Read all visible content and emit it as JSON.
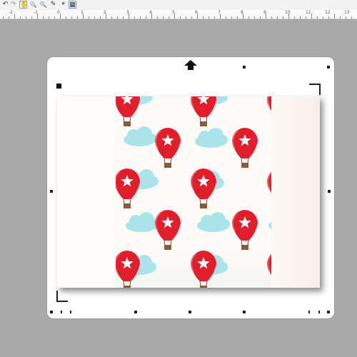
{
  "toolbar": {
    "tools": [
      {
        "name": "undo-icon",
        "glyph": "↶"
      },
      {
        "name": "redo-icon",
        "glyph": "↷"
      },
      {
        "name": "pan-hand-icon",
        "glyph": "✋"
      },
      {
        "name": "zoom-in-icon",
        "glyph": "🔍"
      },
      {
        "name": "zoom-out-icon",
        "glyph": "🔍"
      },
      {
        "name": "pen-icon",
        "glyph": "✎"
      },
      {
        "name": "select-point-icon",
        "glyph": "⌖"
      },
      {
        "name": "grid-icon",
        "glyph": "▦"
      }
    ]
  },
  "ruler": {
    "labels": [
      "-2",
      "-1",
      "0",
      "1",
      "2",
      "3",
      "4",
      "5",
      "6",
      "7",
      "8",
      "9",
      "10",
      "11",
      "12",
      "13"
    ]
  },
  "mat": {
    "direction_arrow": "arrow-up-icon"
  },
  "picture": {
    "subject": "hot-air-balloon pattern image",
    "colors": {
      "balloon": "#e01e2c",
      "balloon_light": "#ff5a63",
      "basket": "#8a5a3c",
      "cloud": "#a9e4ea",
      "star": "#ffffff"
    }
  }
}
